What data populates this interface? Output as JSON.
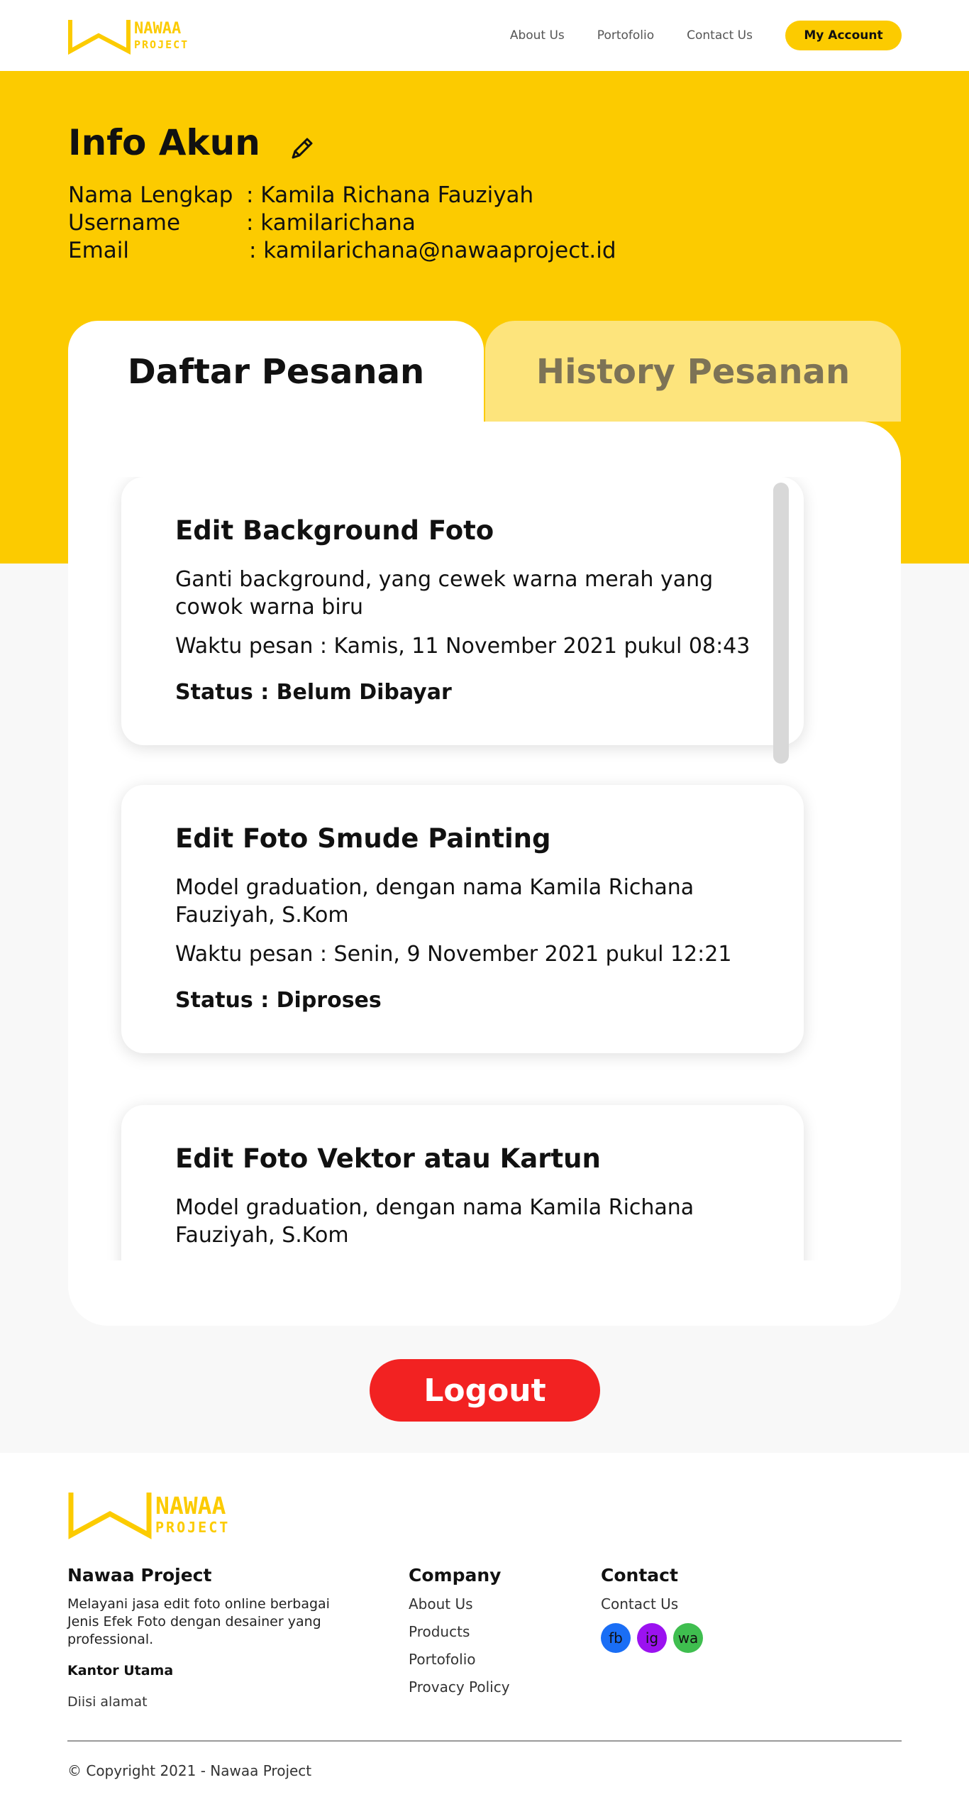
{
  "nav": {
    "logo_line1": "NAWAA",
    "logo_line2": "PROJECT",
    "links": [
      "About Us",
      "Portofolio",
      "Contact Us"
    ],
    "account_button": "My Account"
  },
  "account": {
    "title": "Info Akun",
    "edit_icon": "pencil-icon",
    "rows": [
      {
        "label": "Nama Lengkap",
        "value": ": Kamila Richana Fauziyah"
      },
      {
        "label": "Username",
        "value": ": kamilarichana"
      },
      {
        "label": "Email",
        "value": ": kamilarichana@nawaaproject.id"
      }
    ]
  },
  "tabs": {
    "active": "Daftar Pesanan",
    "inactive": "History Pesanan"
  },
  "orders": [
    {
      "title": "Edit Background Foto",
      "desc": "Ganti background, yang cewek warna merah yang cowok warna biru",
      "time": "Waktu pesan : Kamis, 11 November 2021 pukul 08:43",
      "status": "Status  : Belum Dibayar"
    },
    {
      "title": "Edit Foto Smude Painting",
      "desc": "Model graduation, dengan nama Kamila Richana Fauziyah, S.Kom",
      "time": "Waktu pesan : Senin, 9 November 2021 pukul 12:21",
      "status": "Status  : Diproses"
    },
    {
      "title": "Edit Foto Vektor atau Kartun",
      "desc": "Model graduation, dengan nama Kamila Richana Fauziyah, S.Kom",
      "time": "",
      "status": ""
    }
  ],
  "logout_label": "Logout",
  "footer": {
    "logo_line1": "NAWAA",
    "logo_line2": "PROJECT",
    "brand": {
      "heading": "Nawaa Project",
      "text": "Melayani jasa edit foto online berbagai Jenis Efek Foto dengan desainer yang professional.",
      "office_label": "Kantor Utama",
      "address": "Diisi alamat"
    },
    "company": {
      "heading": "Company",
      "links": [
        "About Us",
        "Products",
        "Portofolio",
        "Provacy Policy"
      ]
    },
    "contact": {
      "heading": "Contact",
      "link": "Contact Us",
      "socials": [
        {
          "label": "fb",
          "color": "#1A6EF5"
        },
        {
          "label": "ig",
          "color": "#9B12F0"
        },
        {
          "label": "wa",
          "color": "#3FBE4F"
        }
      ]
    },
    "copyright": "© Copyright 2021 - Nawaa Project"
  },
  "colors": {
    "brand_yellow": "#FCCB00",
    "tab_inactive": "#FDE47C",
    "logout_red": "#F22222"
  }
}
